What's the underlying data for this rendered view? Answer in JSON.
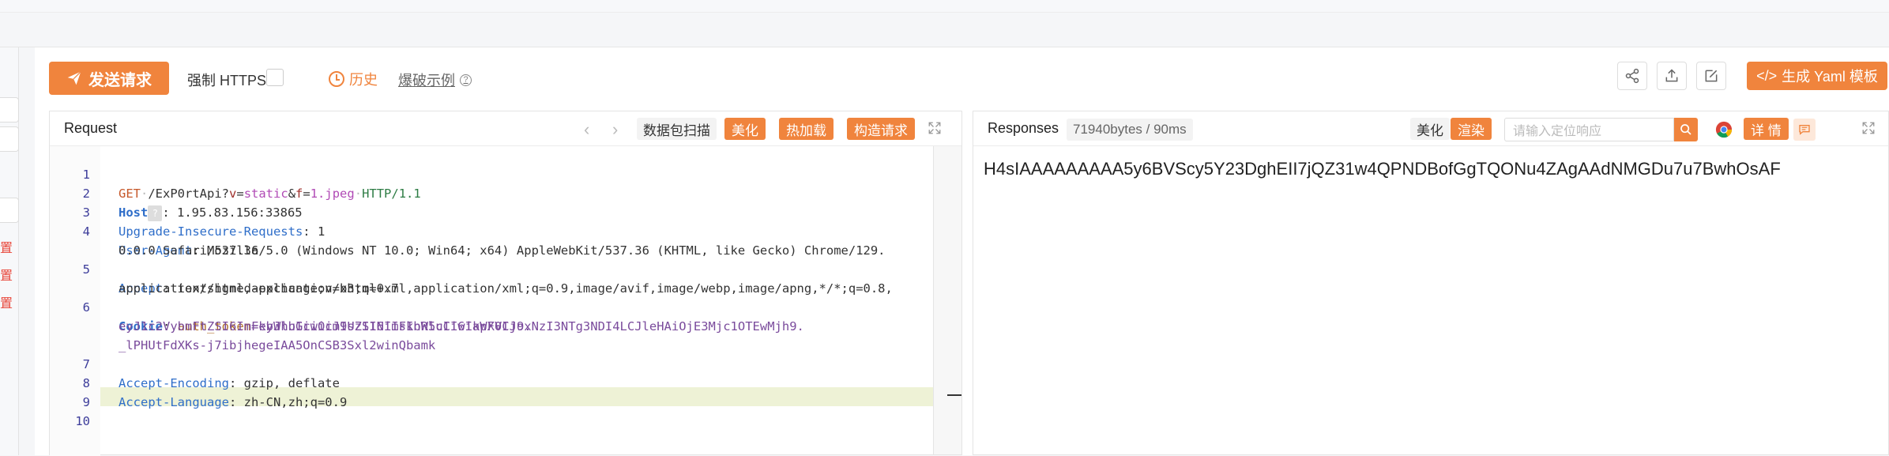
{
  "toolbar": {
    "send_label": "发送请求",
    "https_label": "强制 HTTPS",
    "history_label": "历史",
    "examples_label": "爆破示例",
    "help_glyph": "?",
    "yaml_label": "生成 Yaml 模板",
    "yaml_glyph": "</>"
  },
  "left_rail": {
    "red_items": [
      "置",
      "置",
      "置"
    ]
  },
  "request": {
    "title": "Request",
    "prev_glyph": "‹",
    "next_glyph": "›",
    "scan_label": "数据包扫描",
    "beautify_label": "美化",
    "hotload_label": "热加载",
    "construct_label": "构造请求",
    "lines": [
      {
        "num": "1"
      },
      {
        "num": "2"
      },
      {
        "num": "3"
      },
      {
        "num": "4"
      },
      {
        "num": "5"
      },
      {
        "num": "6"
      },
      {
        "num": "7"
      },
      {
        "num": "8"
      },
      {
        "num": "9"
      },
      {
        "num": "10"
      }
    ],
    "code": {
      "method": "GET",
      "path": "/ExP0rtApi?",
      "p1_name": "v",
      "p1_eq": "=",
      "p1_val": "static",
      "amp": "&",
      "p2_name": "f",
      "p2_eq": "=",
      "p2_val": "1.jpeg",
      "version": "HTTP/1.1",
      "host_key": "Host",
      "host_hint": "?",
      "host_val": ": 1.95.83.156:33865",
      "uir_key": "Upgrade-Insecure-Requests",
      "uir_val": ": 1",
      "ua_key": "User-Agent",
      "ua_val1": ": Mozilla/5.0 (Windows NT 10.0; Win64; x64) AppleWebKit/537.36 (KHTML, like Gecko) Chrome/129.",
      "ua_val2": "0.0.0 Safari/537.36",
      "accept_key": "Accept",
      "accept_val1": ": text/html,application/xhtml+xml,application/xml;q=0.9,image/avif,image/webp,image/apng,*/*;q=0.8,",
      "accept_val2": "application/signed-exchange;v=b3;q=0.7",
      "cookie_key": "Cookie",
      "cookie_colon": ": ",
      "cookie_name": "auth_token",
      "cookie_val1": "=eyJhbGciOiJIUzI1NiIsInR5cCI6IkpXVCJ9.",
      "cookie_val2": "eyJ1c2VybmFtZSI6ImFkbWluIiwicm9sZSI6ImFkbWluIiwiaWF0IjoxNzI3NTg3NDI4LCJleHAiOjE3Mjc1OTEwMjh9.",
      "cookie_val3": "_lPHUtFdXKs-j7ibjhegeIAA5OnCSB3Sxl2winQbamk",
      "ae_key": "Accept-Encoding",
      "ae_val": ": gzip, deflate",
      "al_key": "Accept-Language",
      "al_val": ": zh-CN,zh;q=0.9"
    }
  },
  "response": {
    "title": "Responses",
    "meta": "71940bytes / 90ms",
    "beautify_label": "美化",
    "render_label": "渲染",
    "search_placeholder": "请输入定位响应",
    "detail_label": "详 情",
    "body": "H4sIAAAAAAAAA5y6BVScy5Y23DghEII7jQZ31w4QPNDBofGgTQONu4ZAgAAdNMGDu7u7BwhOsAF"
  },
  "colors": {
    "accent": "#f0843d",
    "active_line": "#eef2d6"
  }
}
